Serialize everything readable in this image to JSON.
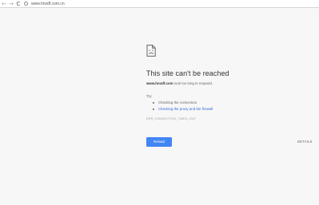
{
  "browser": {
    "back_icon": "arrow-left-icon",
    "forward_icon": "arrow-right-icon",
    "reload_icon": "reload-icon",
    "back_glyph": "←",
    "forward_glyph": "→",
    "reload_glyph": "C",
    "url": "www.hnxdf.com.cn"
  },
  "error": {
    "icon": "sad-document-icon",
    "heading": "This site can't be reached",
    "domain": "www.hnxdf.com",
    "summary_rest": " took too long to respond.",
    "try_label": "Try:",
    "suggestions": [
      "Checking the connection",
      "Checking the proxy and the firewall"
    ],
    "error_code": "ERR_CONNECTION_TIMED_OUT",
    "reload_label": "Reload",
    "details_label": "DETAILS"
  },
  "colors": {
    "page_background": "#f7f7f7",
    "button_blue": "#4285f4",
    "link_blue": "#3367d6"
  }
}
